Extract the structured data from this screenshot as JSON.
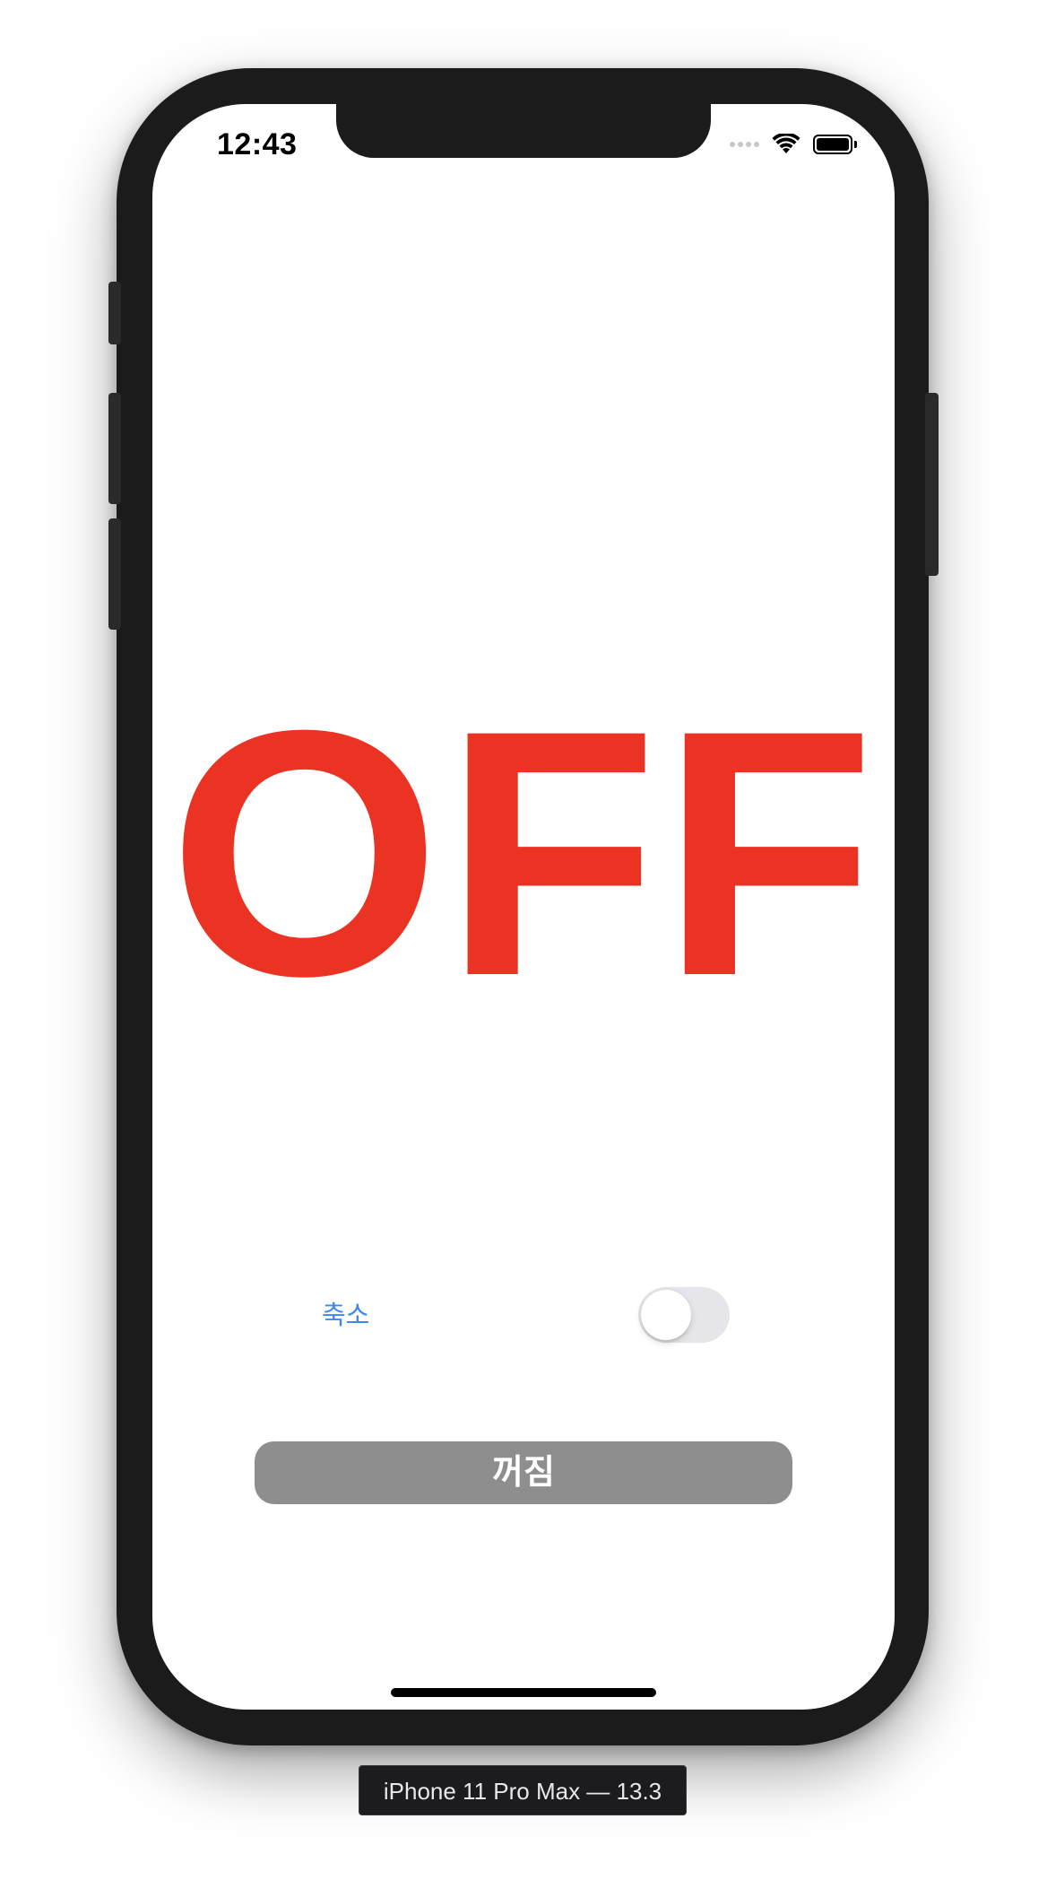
{
  "status_bar": {
    "time": "12:43",
    "icons": [
      "cellular-signal-icon",
      "wifi-icon",
      "battery-icon"
    ]
  },
  "main": {
    "state_label": "OFF",
    "state_color": "#eb3323",
    "cancel_label": "축소",
    "toggle_on": false,
    "power_button_label": "꺼짐"
  },
  "colors": {
    "link_blue": "#3d89ea",
    "button_gray": "#8e8e8e",
    "toggle_off_track": "#e5e5ea"
  },
  "device_label": "iPhone 11 Pro Max — 13.3"
}
